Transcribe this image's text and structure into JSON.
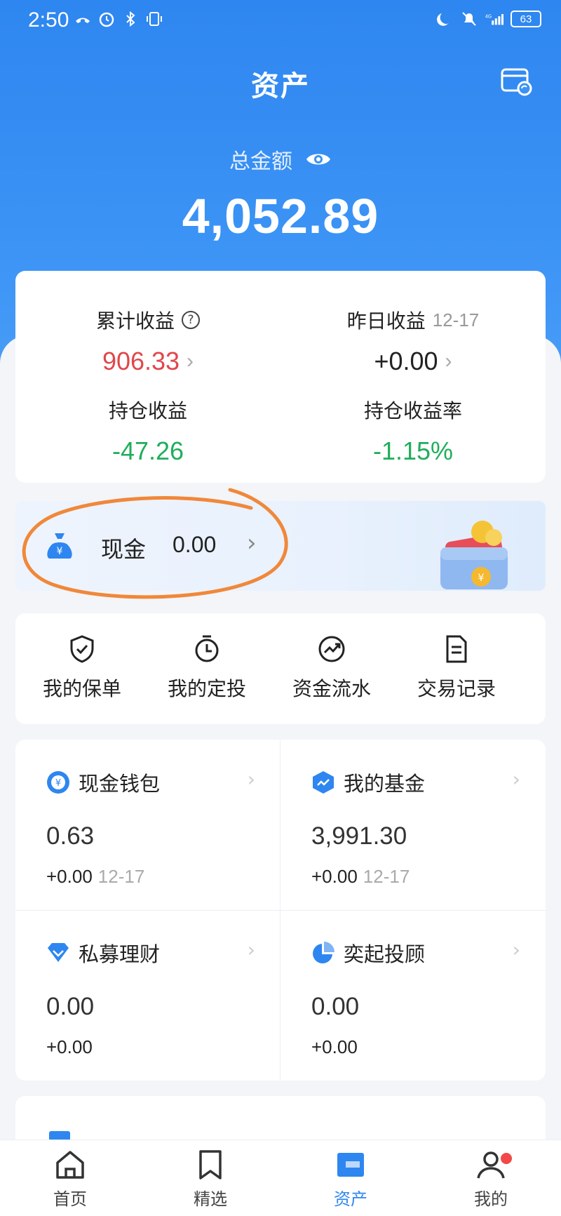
{
  "status_bar": {
    "time": "2:50",
    "battery": "63"
  },
  "header": {
    "title": "资产",
    "total_label": "总金额",
    "total_amount": "4,052.89"
  },
  "earnings": {
    "cumulative_label": "累计收益",
    "cumulative_value": "906.33",
    "yesterday_label": "昨日收益",
    "yesterday_date": "12-17",
    "yesterday_value": "+0.00",
    "holding_label": "持仓收益",
    "holding_value": "-47.26",
    "holding_rate_label": "持仓收益率",
    "holding_rate_value": "-1.15%"
  },
  "cash": {
    "label": "现金",
    "value": "0.00"
  },
  "shortcuts": [
    {
      "label": "我的保单",
      "icon": "shield-check-icon"
    },
    {
      "label": "我的定投",
      "icon": "alarm-clock-icon"
    },
    {
      "label": "资金流水",
      "icon": "trend-circle-icon"
    },
    {
      "label": "交易记录",
      "icon": "document-icon"
    }
  ],
  "products": [
    {
      "name": "现金钱包",
      "value": "0.63",
      "change": "+0.00",
      "date": "12-17",
      "icon": "cash-wallet-icon"
    },
    {
      "name": "我的基金",
      "value": "3,991.30",
      "change": "+0.00",
      "date": "12-17",
      "icon": "fund-icon"
    },
    {
      "name": "私募理财",
      "value": "0.00",
      "change": "+0.00",
      "date": "",
      "icon": "private-fund-icon"
    },
    {
      "name": "奕起投顾",
      "value": "0.00",
      "change": "+0.00",
      "date": "",
      "icon": "advisor-pie-icon"
    }
  ],
  "tabs": [
    {
      "label": "首页",
      "icon": "home-icon",
      "active": false
    },
    {
      "label": "精选",
      "icon": "bookmark-icon",
      "active": false
    },
    {
      "label": "资产",
      "icon": "assets-icon",
      "active": true
    },
    {
      "label": "我的",
      "icon": "profile-icon",
      "active": false
    }
  ],
  "colors": {
    "brand": "#2e86f0",
    "positive_red": "#e0474b",
    "negative_green": "#1fae5b",
    "annotation_orange": "#f0883a"
  }
}
